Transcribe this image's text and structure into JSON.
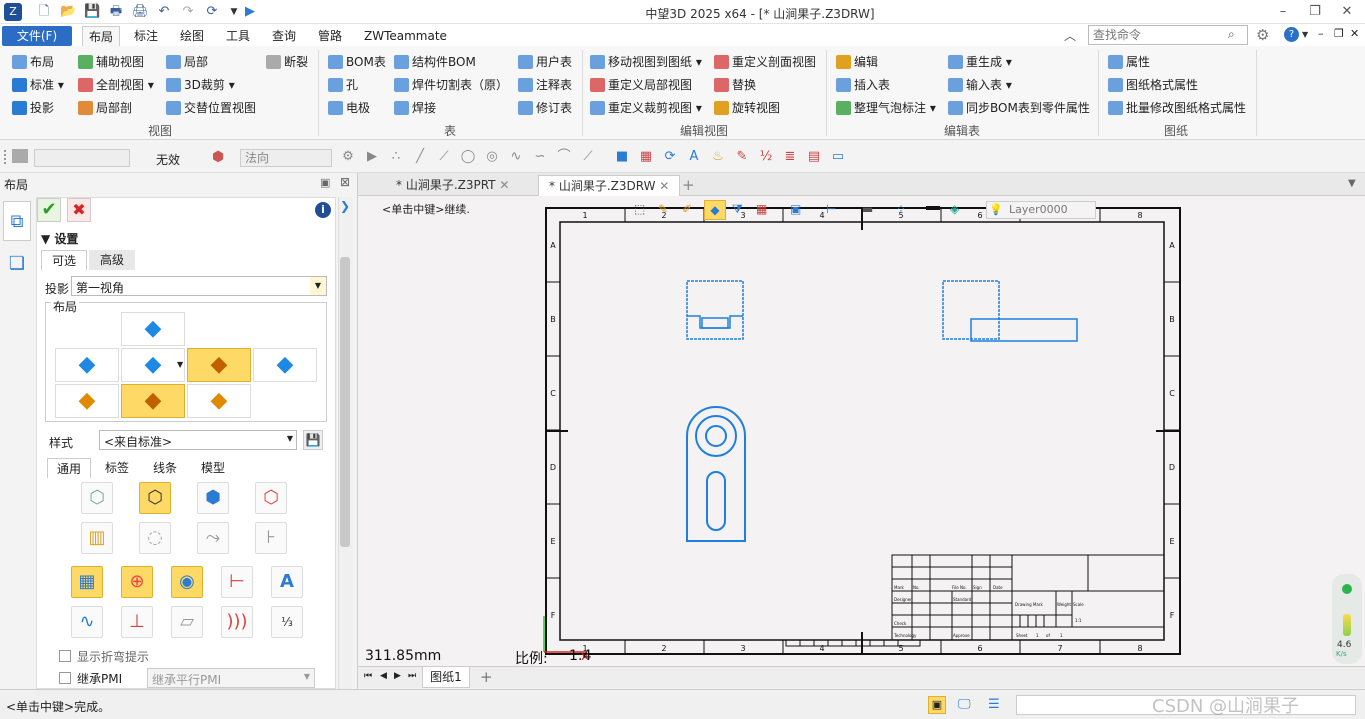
{
  "app": {
    "title": "中望3D 2025 x64 - [* 山涧果子.Z3DRW]"
  },
  "menu": {
    "file": "文件(F)",
    "tabs": [
      "布局",
      "标注",
      "绘图",
      "工具",
      "查询",
      "管路",
      "ZWTeammate"
    ],
    "search_placeholder": "查找命令"
  },
  "ribbon": {
    "view": {
      "items": [
        "布局",
        "辅助视图",
        "局部",
        "断裂",
        "标准",
        "全剖视图",
        "3D裁剪",
        "投影",
        "局部剖",
        "交替位置视图"
      ],
      "label": "视图"
    },
    "table": {
      "items": [
        "BOM表",
        "结构件BOM",
        "用户表",
        "孔",
        "焊件切割表（原）",
        "注释表",
        "电极",
        "焊接",
        "修订表"
      ],
      "label": "表"
    },
    "edit_view": {
      "items": [
        "移动视图到图纸",
        "重定义剖面视图",
        "重定义局部视图",
        "替换",
        "重定义裁剪视图",
        "旋转视图"
      ],
      "label": "编辑视图"
    },
    "edit_table": {
      "items": [
        "编辑",
        "重生成",
        "插入表",
        "输入表",
        "整理气泡标注",
        "同步BOM表到零件属性"
      ],
      "label": "编辑表"
    },
    "drawing": {
      "items": [
        "属性",
        "图纸格式属性",
        "批量修改图纸格式属性"
      ],
      "label": "图纸"
    }
  },
  "toolbar2": {
    "invalid": "无效",
    "direction": "法向"
  },
  "panel": {
    "title": "布局",
    "settings": "设置",
    "tabs": [
      "可选",
      "高级"
    ],
    "projection_label": "投影",
    "projection_value": "第一视角",
    "layout_label": "布局",
    "style_label": "样式",
    "style_value": "<来自标准>",
    "style_tabs": [
      "通用",
      "标签",
      "线条",
      "模型"
    ],
    "show_bend": "显示折弯提示",
    "inherit_pmi": "继承PMI",
    "inherit_parallel_pmi": "继承平行PMI"
  },
  "doc_tabs": [
    "* 山涧果子.Z3PRT",
    "* 山涧果子.Z3DRW"
  ],
  "canvas": {
    "hint": "<单击中键>继续.",
    "layer": "Layer0000",
    "length": "311.85mm",
    "scale_label": "比例:",
    "scale_value": "1:4",
    "col_numbers": [
      "1",
      "2",
      "3",
      "4",
      "5",
      "6",
      "7",
      "8"
    ],
    "row_letters": [
      "A",
      "B",
      "C",
      "D",
      "E",
      "F"
    ],
    "title_block": [
      "Mark",
      "No.",
      "File No.",
      "Sign",
      "Date",
      "Designer",
      "Standard",
      "Check",
      "Technology",
      "Approve",
      "Drawing Mark",
      "Weight",
      "Scale",
      "1:1",
      "Sheet",
      "1",
      "of",
      "1"
    ]
  },
  "sheet_tab": "图纸1",
  "status": {
    "text": "<单击中键>完成。",
    "watermark": "CSDN @山涧果子"
  },
  "perf": {
    "value": "4.6",
    "unit": "K/s"
  }
}
